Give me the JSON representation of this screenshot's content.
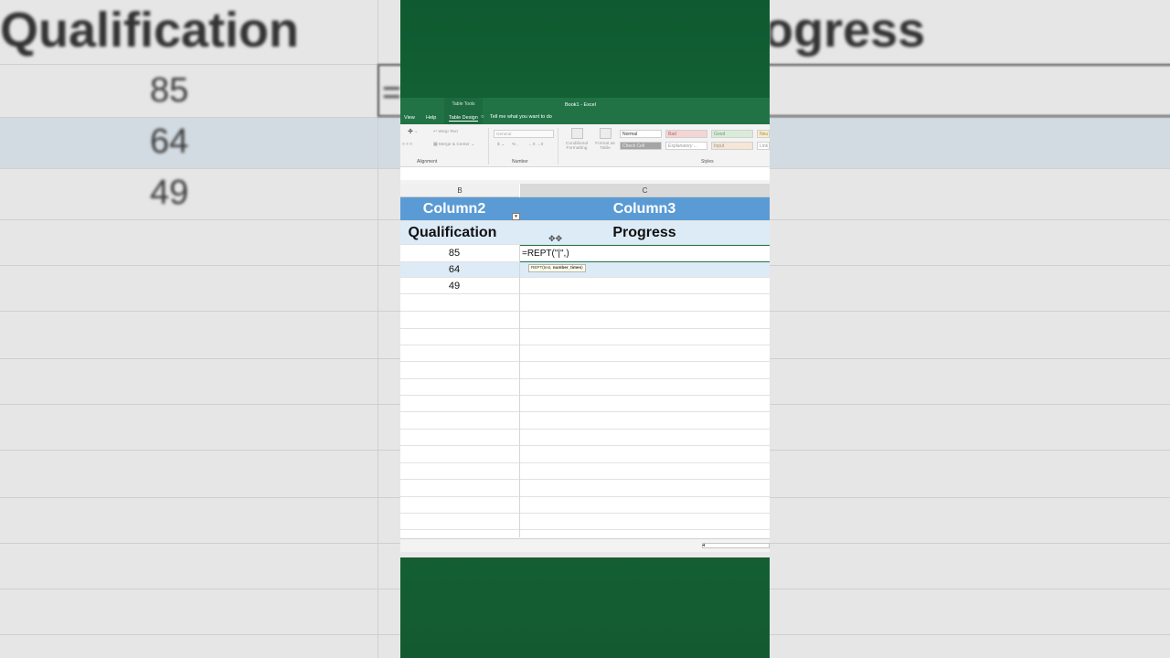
{
  "background": {
    "left_header": "Qualification",
    "right_header": "Progress",
    "values": [
      "85",
      "64",
      "49"
    ],
    "cell_prefix": "="
  },
  "titlebar": {
    "contextual_tab_group": "Table Tools",
    "document_title": "Book1  -  Excel",
    "tabs": [
      "View",
      "Help",
      "Table Design"
    ],
    "active_tab": "Table Design",
    "tell_me": "Tell me what you want to do"
  },
  "ribbon": {
    "wrap_text": "Wrap Text",
    "merge_center": "Merge & Center",
    "number_format": "General",
    "currency": "$",
    "percent": "%",
    "conditional_formatting": "Conditional Formatting",
    "format_as_table": "Format as Table",
    "styles": [
      "Normal",
      "Bad",
      "Good",
      "Neu",
      "Check Cell",
      "Explanatory ...",
      "Input",
      "Link"
    ],
    "groups": [
      "Alignment",
      "Number",
      "Styles"
    ]
  },
  "columns": {
    "b": "B",
    "c": "C"
  },
  "table": {
    "header_row": [
      "Column2",
      "Column3"
    ],
    "label_row": [
      "Qualification",
      "Progress"
    ],
    "rows": [
      {
        "qualification": "85",
        "progress": "=REPT(\"|\",)"
      },
      {
        "qualification": "64",
        "progress": ""
      },
      {
        "qualification": "49",
        "progress": ""
      }
    ]
  },
  "formula_tooltip": {
    "fn": "REPT(text, ",
    "arg": "number_times",
    "close": ")"
  },
  "colors": {
    "excel_green": "#217346",
    "table_header": "#5b9bd5",
    "table_band": "#ddebf7"
  }
}
